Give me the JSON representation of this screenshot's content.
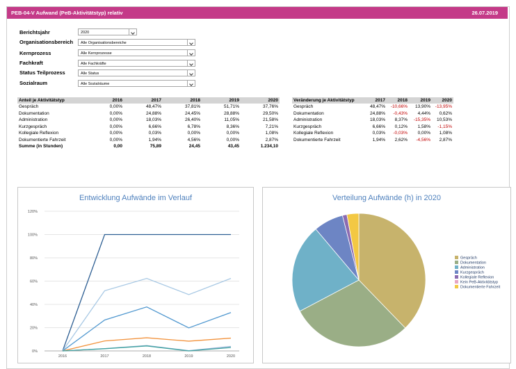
{
  "header": {
    "title": "PEB-04-V Aufwand (PeB-Aktivitätstyp) relativ",
    "date": "26.07.2019"
  },
  "filters": [
    {
      "label": "Berichtsjahr",
      "value": "2020"
    },
    {
      "label": "Organisationsbereich",
      "value": "Alle Organisationsbereiche"
    },
    {
      "label": "Kernprozess",
      "value": "Alle Kernprozesse"
    },
    {
      "label": "Fachkraft",
      "value": "Alle Fachkräfte"
    },
    {
      "label": "Status Teilprozess",
      "value": "Alle Status"
    },
    {
      "label": "Sozialraum",
      "value": "Alle Sozialräume"
    }
  ],
  "share_table": {
    "headers": [
      "Anteil je Aktivitätstyp",
      "2016",
      "2017",
      "2018",
      "2019",
      "2020"
    ],
    "rows": [
      [
        "Gespräch",
        "0,00%",
        "48,47%",
        "37,81%",
        "51,71%",
        "37,76%"
      ],
      [
        "Dokumentation",
        "0,00%",
        "24,88%",
        "24,45%",
        "28,88%",
        "29,50%"
      ],
      [
        "Administration",
        "0,00%",
        "18,03%",
        "26,40%",
        "11,05%",
        "21,58%"
      ],
      [
        "Kurzgespräch",
        "0,00%",
        "6,66%",
        "6,78%",
        "8,36%",
        "7,21%"
      ],
      [
        "Kollegiale Reflexion",
        "0,00%",
        "0,03%",
        "0,00%",
        "0,00%",
        "1,08%"
      ],
      [
        "Dokumentierte Fahrzeit",
        "0,00%",
        "1,94%",
        "4,56%",
        "0,00%",
        "2,87%"
      ]
    ],
    "sum_row": [
      "Summe (in Stunden)",
      "0,00",
      "75,89",
      "24,45",
      "43,45",
      "1.234,10"
    ]
  },
  "change_table": {
    "headers": [
      "Veränderung je Aktivitätstyp",
      "2017",
      "2018",
      "2019",
      "2020"
    ],
    "rows": [
      [
        "Gespräch",
        "48,47%",
        "-10,66%",
        "13,90%",
        "-13,95%"
      ],
      [
        "Dokumentation",
        "24,88%",
        "-0,43%",
        "4,44%",
        "0,62%"
      ],
      [
        "Administration",
        "18,03%",
        "8,37%",
        "-15,35%",
        "10,53%"
      ],
      [
        "Kurzgespräch",
        "6,66%",
        "0,12%",
        "1,58%",
        "-1,15%"
      ],
      [
        "Kollegiale Reflexion",
        "0,03%",
        "-0,03%",
        "0,00%",
        "1,08%"
      ],
      [
        "Dokumentierte Fahrzeit",
        "1,94%",
        "2,62%",
        "-4,56%",
        "2,87%"
      ]
    ]
  },
  "chart_data": [
    {
      "type": "line",
      "title": "Entwicklung Aufwände im Verlauf",
      "x": [
        "2016",
        "2017",
        "2018",
        "2019",
        "2020"
      ],
      "y_ticks": [
        "0%",
        "20%",
        "40%",
        "60%",
        "80%",
        "100%",
        "120%"
      ],
      "ylim": [
        0,
        120
      ],
      "grid": true,
      "series": [
        {
          "color": "#2e5f93",
          "values": [
            0,
            100,
            100,
            100,
            100
          ]
        },
        {
          "color": "#a7c8e4",
          "values": [
            0,
            51.7,
            62.3,
            48.4,
            62.3
          ]
        },
        {
          "color": "#4f97cf",
          "values": [
            0,
            26.6,
            37.8,
            19.8,
            33
          ]
        },
        {
          "color": "#f2923c",
          "values": [
            0,
            8.6,
            11.3,
            8.4,
            11
          ]
        },
        {
          "color": "#8fb0d4",
          "values": [
            0,
            2,
            4.6,
            0.2,
            3.9
          ]
        },
        {
          "color": "#41a3a0",
          "values": [
            0,
            1.9,
            4.3,
            0,
            2.9
          ]
        }
      ]
    },
    {
      "type": "pie",
      "title": "Verteilung Aufwände (h) in 2020",
      "legend_position": "right",
      "labels": [
        "Gespräch",
        "Dokumentation",
        "Administration",
        "Kurzgespräch",
        "Kollegiale Reflexion",
        "Kein PeB-Aktivitätstyp",
        "Dokumentierte Fahrzeit"
      ],
      "values": [
        37.76,
        29.5,
        21.58,
        7.21,
        1.08,
        0,
        2.87
      ],
      "colors": [
        "#c7b36c",
        "#9aae86",
        "#6fb1c8",
        "#6d85c4",
        "#8c6bb1",
        "#e7a6c4",
        "#f3c843"
      ]
    }
  ]
}
